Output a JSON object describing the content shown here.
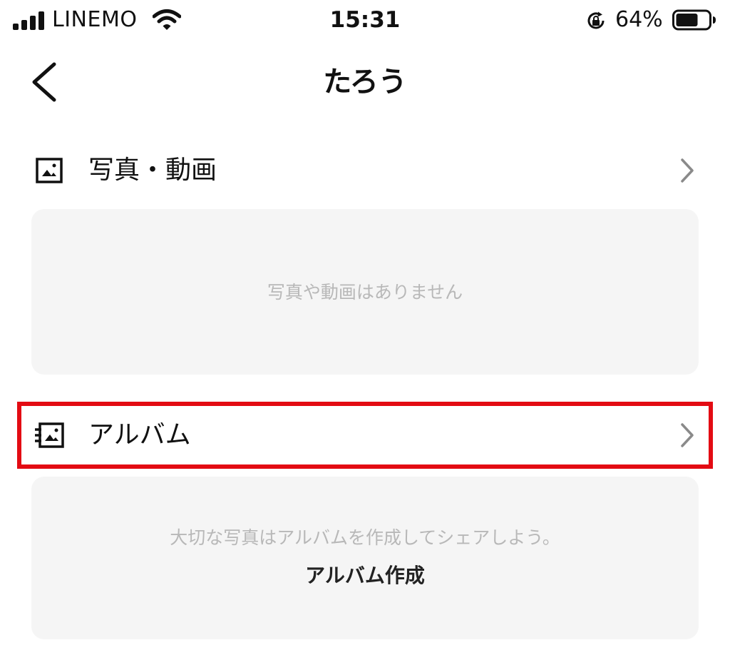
{
  "status_bar": {
    "carrier": "LINEMO",
    "time": "15:31",
    "battery_percent": "64%",
    "signal_bars": 4,
    "battery_level": 0.64
  },
  "header": {
    "title": "たろう",
    "back_icon": "chevron-left-icon"
  },
  "photos_section": {
    "label": "写真・動画",
    "icon": "photo-icon",
    "chevron_icon": "chevron-right-icon",
    "empty_message": "写真や動画はありません"
  },
  "album_section": {
    "label": "アルバム",
    "icon": "album-icon",
    "chevron_icon": "chevron-right-icon",
    "empty_message": "大切な写真はアルバムを作成してシェアしよう。",
    "create_label": "アルバム作成"
  },
  "colors": {
    "highlight": "#e30b13",
    "card_background": "#f5f5f5",
    "muted_text": "#b8b8b8"
  }
}
